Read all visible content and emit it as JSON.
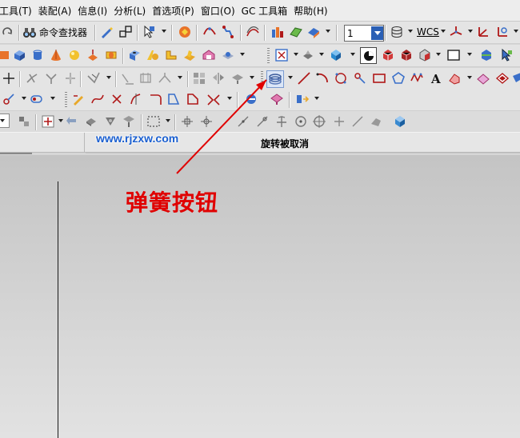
{
  "menubar": {
    "items": [
      "工具(T)",
      "装配(A)",
      "信息(I)",
      "分析(L)",
      "首选项(P)",
      "窗口(O)",
      "GC 工具箱",
      "帮助(H)"
    ]
  },
  "toolbar": {
    "command_finder_label": "命令查找器",
    "layer_value": "1",
    "wcs_label": "WCS"
  },
  "status": {
    "prompt_text": "旋转被取消"
  },
  "watermark": {
    "text": "www.rjzxw.com"
  },
  "annotation": {
    "text": "弹簧按钮",
    "color": "#e00000"
  },
  "colors": {
    "accent_blue": "#2a5fb5",
    "arrow_red": "#e00000"
  }
}
